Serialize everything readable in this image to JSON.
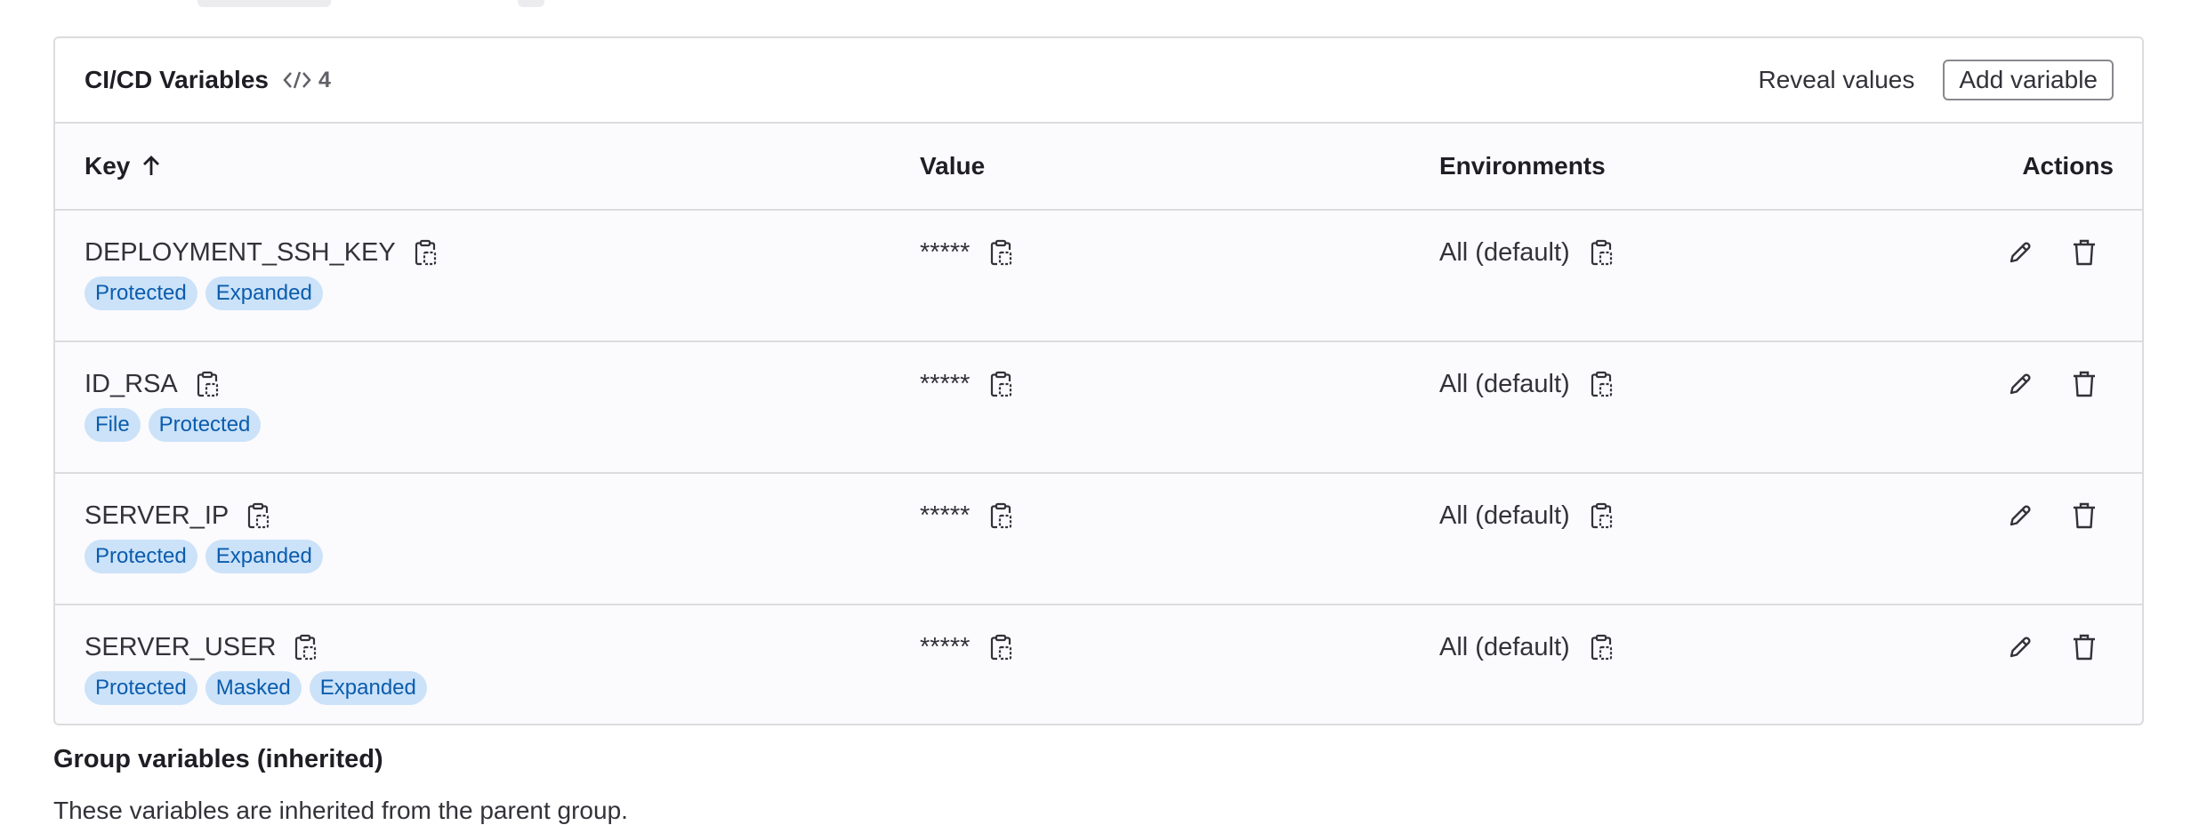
{
  "header": {
    "title": "CI/CD Variables",
    "count": "4",
    "count_icon": "code-icon",
    "reveal_label": "Reveal values",
    "add_label": "Add variable"
  },
  "table": {
    "columns": {
      "key": "Key",
      "value": "Value",
      "environments": "Environments",
      "actions": "Actions"
    },
    "sort_icon": "arrow-up-icon",
    "rows": [
      {
        "key": "DEPLOYMENT_SSH_KEY",
        "badges": [
          "Protected",
          "Expanded"
        ],
        "value": "*****",
        "env": "All (default)"
      },
      {
        "key": "ID_RSA",
        "badges": [
          "File",
          "Protected"
        ],
        "value": "*****",
        "env": "All (default)"
      },
      {
        "key": "SERVER_IP",
        "badges": [
          "Protected",
          "Expanded"
        ],
        "value": "*****",
        "env": "All (default)"
      },
      {
        "key": "SERVER_USER",
        "badges": [
          "Protected",
          "Masked",
          "Expanded"
        ],
        "value": "*****",
        "env": "All (default)"
      }
    ]
  },
  "group_section": {
    "title": "Group variables (inherited)",
    "description": "These variables are inherited from the parent group."
  },
  "colors": {
    "badge_bg": "#cbe2f9",
    "badge_text": "#0b5cad",
    "border": "#dcdcde"
  }
}
